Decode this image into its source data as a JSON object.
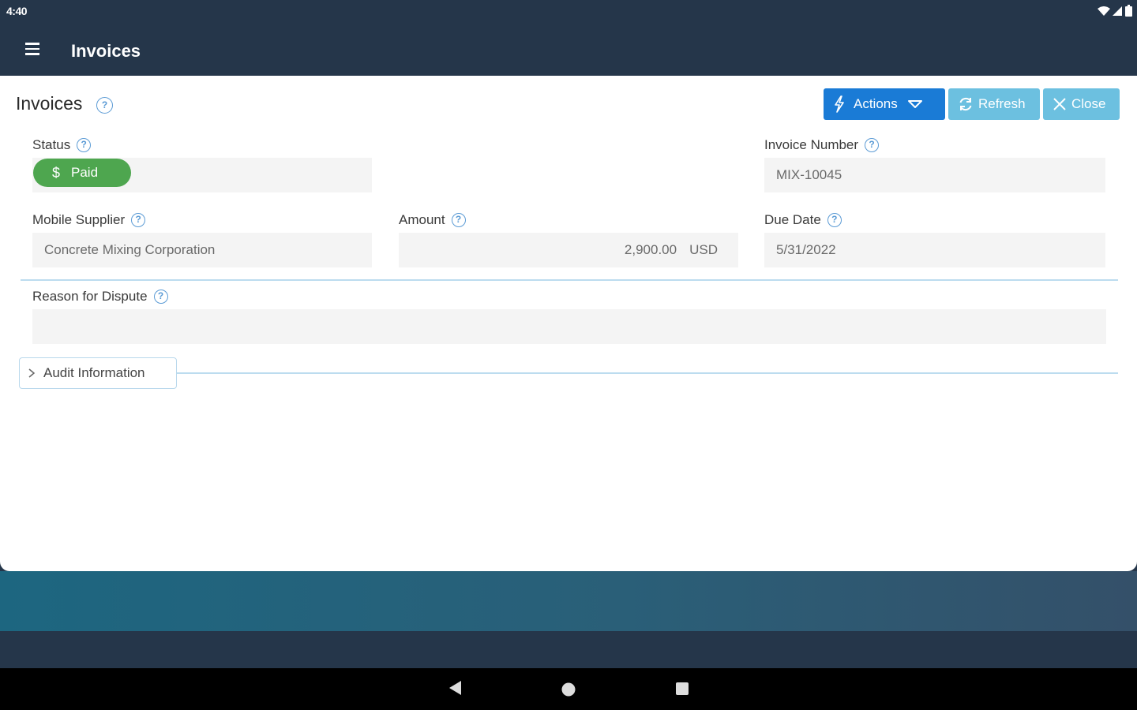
{
  "statusbar": {
    "time": "4:40"
  },
  "appbar": {
    "title": "Invoices"
  },
  "page": {
    "title": "Invoices"
  },
  "toolbar": {
    "actions_label": "Actions",
    "refresh_label": "Refresh",
    "close_label": "Close"
  },
  "fields": {
    "status": {
      "label": "Status",
      "value": "Paid"
    },
    "invoice_number": {
      "label": "Invoice Number",
      "value": "MIX-10045"
    },
    "mobile_supplier": {
      "label": "Mobile Supplier",
      "value": "Concrete Mixing Corporation"
    },
    "amount": {
      "label": "Amount",
      "value": "2,900.00",
      "currency": "USD"
    },
    "due_date": {
      "label": "Due Date",
      "value": "5/31/2022"
    },
    "reason_for_dispute": {
      "label": "Reason for Dispute",
      "value": ""
    }
  },
  "audit": {
    "label": "Audit Information"
  },
  "colors": {
    "app_bar": "#25364a",
    "primary_button": "#1a7bd6",
    "secondary_button": "#6cc0e0",
    "status_paid": "#4ea64f",
    "help_icon": "#5b9bd5"
  },
  "icons": [
    "menu-icon",
    "help-icon",
    "lightning-icon",
    "caret-down-icon",
    "refresh-icon",
    "close-icon",
    "dollar-icon",
    "chevron-right-icon",
    "wifi-icon",
    "signal-icon",
    "battery-icon",
    "back-icon",
    "home-icon",
    "recents-icon"
  ]
}
